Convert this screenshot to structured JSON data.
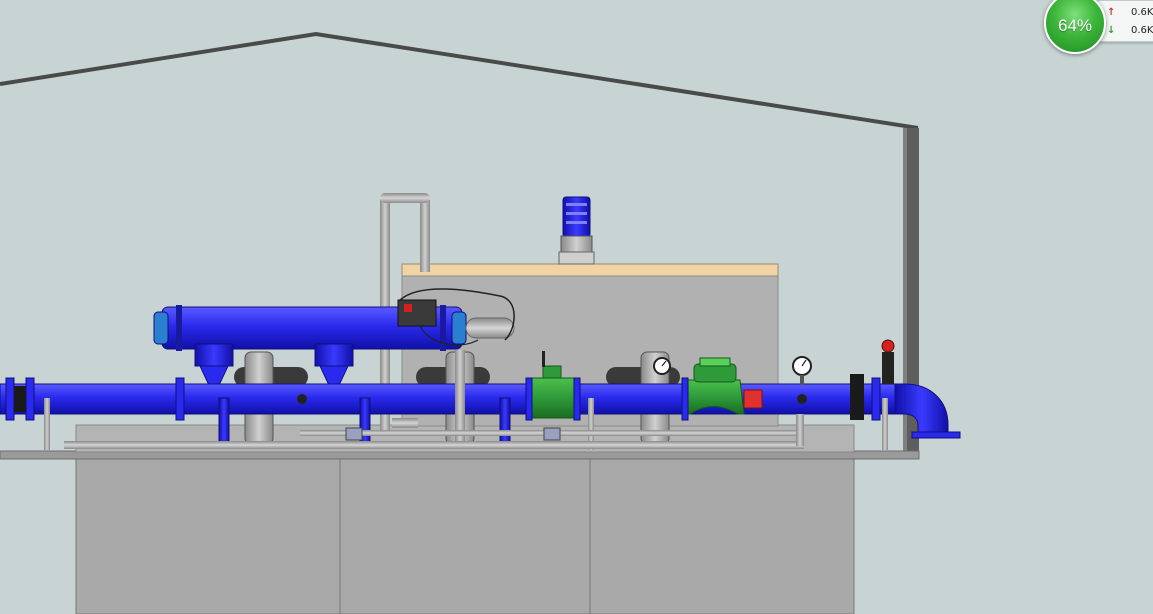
{
  "network_monitor": {
    "usage_percent": "64%",
    "upload_icon": "arrow-up-icon",
    "download_icon": "arrow-down-icon",
    "upload_rate": "0.6K",
    "download_rate": "0.6K",
    "gauge_color": "#3cb53a"
  },
  "scene": {
    "background_color": "#c8d4d4",
    "pipe_color": "#2a2aee",
    "valve_color": "#2e9a3a",
    "structure_color": "#a9a9a9"
  }
}
